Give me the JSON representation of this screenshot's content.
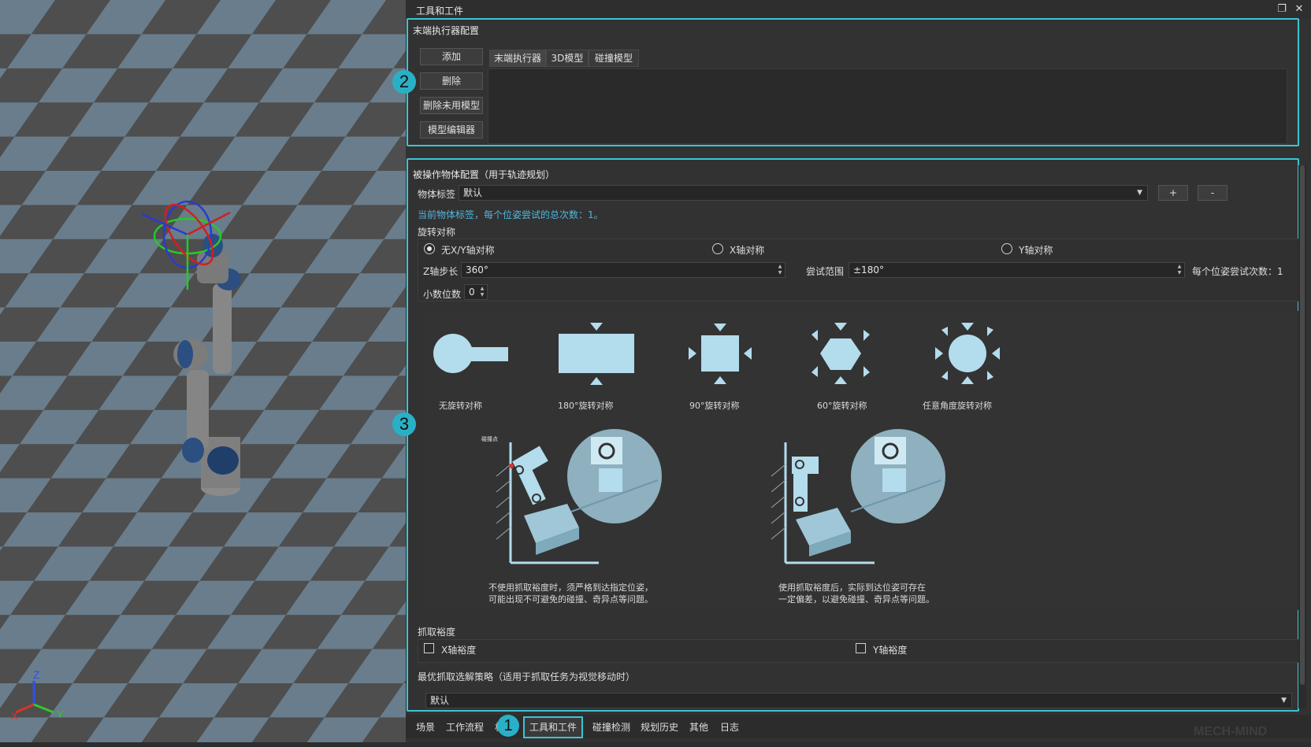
{
  "window": {
    "title": "工具和工件"
  },
  "end_effector": {
    "section_title": "末端执行器配置",
    "buttons": {
      "add": "添加",
      "delete": "删除",
      "delete_unused": "删除未用模型",
      "model_editor": "模型编辑器"
    },
    "tabs": [
      "末端执行器",
      "3D模型",
      "碰撞模型"
    ]
  },
  "workpiece": {
    "section_title": "被操作物体配置（用于轨迹规划）",
    "object_label_caption": "物体标签",
    "object_label_value": "默认",
    "add_button": "+",
    "remove_button": "-",
    "info_text": "当前物体标签，每个位姿尝试的总次数：1。",
    "rotation_symmetry_title": "旋转对称",
    "radio_options": [
      "无X/Y轴对称",
      "X轴对称",
      "Y轴对称"
    ],
    "z_step_label": "Z轴步长",
    "z_step_value": "360°",
    "try_range_label": "尝试范围",
    "try_range_value": "±180°",
    "attempts_label": "每个位姿尝试次数：1",
    "decimals_label": "小数位数",
    "decimals_value": "0",
    "symmetry_captions": [
      "无旋转对称",
      "180°旋转对称",
      "90°旋转对称",
      "60°旋转对称",
      "任意角度旋转对称"
    ],
    "collision_point_label": "碰撞点",
    "illus_caption_left": [
      "不使用抓取裕度时，须严格到达指定位姿，",
      "可能出现不可避免的碰撞、奇异点等问题。"
    ],
    "illus_caption_right": [
      "使用抓取裕度后，实际到达位姿可存在",
      "一定偏差，以避免碰撞、奇异点等问题。"
    ],
    "grasp_margin_title": "抓取裕度",
    "x_margin_label": "X轴裕度",
    "y_margin_label": "Y轴裕度",
    "strategy_title": "最优抓取选解策略（适用于抓取任务为视觉移动时）",
    "strategy_value": "默认"
  },
  "bottom_tabs": [
    "场景",
    "工作流程",
    "机",
    "工具和工件",
    "碰撞检测",
    "规划历史",
    "其他",
    "日志"
  ],
  "badges": [
    "1",
    "2",
    "3"
  ],
  "axis_labels": {
    "z": "Z",
    "x": "X",
    "y": "Y"
  },
  "watermark": "MECH-MIND",
  "colors": {
    "accent": "#3cc4d4",
    "info_text": "#4fb7e0",
    "illustration": "#b3dcec"
  }
}
